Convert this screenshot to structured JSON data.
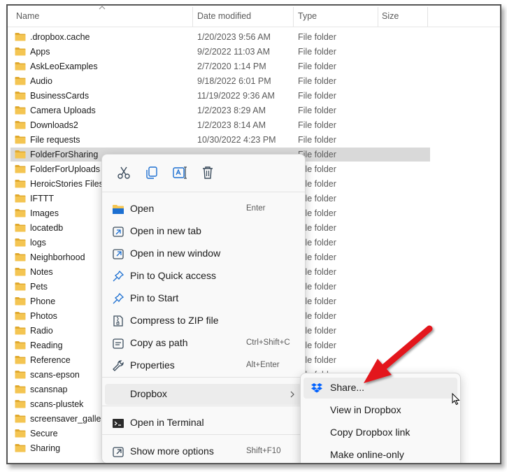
{
  "columns": [
    "Name",
    "Date modified",
    "Type",
    "Size"
  ],
  "rows": [
    {
      "name": ".dropbox.cache",
      "date": "1/20/2023 9:56 AM",
      "type": "File folder"
    },
    {
      "name": "Apps",
      "date": "9/2/2022 11:03 AM",
      "type": "File folder"
    },
    {
      "name": "AskLeoExamples",
      "date": "2/7/2020 1:14 PM",
      "type": "File folder"
    },
    {
      "name": "Audio",
      "date": "9/18/2022 6:01 PM",
      "type": "File folder"
    },
    {
      "name": "BusinessCards",
      "date": "11/19/2022 9:36 AM",
      "type": "File folder"
    },
    {
      "name": "Camera Uploads",
      "date": "1/2/2023 8:29 AM",
      "type": "File folder"
    },
    {
      "name": "Downloads2",
      "date": "1/2/2023 8:14 AM",
      "type": "File folder"
    },
    {
      "name": "File requests",
      "date": "10/30/2022 4:23 PM",
      "type": "File folder"
    },
    {
      "name": "FolderForSharing",
      "date": "",
      "type": "File folder",
      "selected": true
    },
    {
      "name": "FolderForUploads",
      "date": "",
      "type": "File folder"
    },
    {
      "name": "HeroicStories Files",
      "date": "",
      "type": "File folder"
    },
    {
      "name": "IFTTT",
      "date": "",
      "type": "File folder"
    },
    {
      "name": "Images",
      "date": "",
      "type": "File folder"
    },
    {
      "name": "locatedb",
      "date": "",
      "type": "File folder"
    },
    {
      "name": "logs",
      "date": "",
      "type": "File folder"
    },
    {
      "name": "Neighborhood",
      "date": "",
      "type": "File folder"
    },
    {
      "name": "Notes",
      "date": "",
      "type": "File folder"
    },
    {
      "name": "Pets",
      "date": "",
      "type": "File folder"
    },
    {
      "name": "Phone",
      "date": "",
      "type": "File folder"
    },
    {
      "name": "Photos",
      "date": "",
      "type": "File folder"
    },
    {
      "name": "Radio",
      "date": "",
      "type": "File folder"
    },
    {
      "name": "Reading",
      "date": "",
      "type": "File folder"
    },
    {
      "name": "Reference",
      "date": "",
      "type": "File folder"
    },
    {
      "name": "scans-epson",
      "date": "",
      "type": "File folder"
    },
    {
      "name": "scansnap",
      "date": "",
      "type": "File folder"
    },
    {
      "name": "scans-plustek",
      "date": "",
      "type": "File folder"
    },
    {
      "name": "screensaver_gallery",
      "date": "",
      "type": "File folder"
    },
    {
      "name": "Secure",
      "date": "",
      "type": "File folder"
    },
    {
      "name": "Sharing",
      "date": "",
      "type": "File folder"
    }
  ],
  "context_menu": {
    "quick_actions": [
      {
        "icon": "scissors-icon",
        "name": "cut"
      },
      {
        "icon": "copy-icon",
        "name": "copy"
      },
      {
        "icon": "rename-icon",
        "name": "rename"
      },
      {
        "icon": "trash-icon",
        "name": "delete"
      }
    ],
    "items": [
      {
        "label": "Open",
        "shortcut": "Enter",
        "icon": "folder-open-icon"
      },
      {
        "label": "Open in new tab",
        "shortcut": "",
        "icon": "new-tab-icon"
      },
      {
        "label": "Open in new window",
        "shortcut": "",
        "icon": "new-window-icon"
      },
      {
        "label": "Pin to Quick access",
        "shortcut": "",
        "icon": "pin-icon"
      },
      {
        "label": "Pin to Start",
        "shortcut": "",
        "icon": "pin-start-icon"
      },
      {
        "label": "Compress to ZIP file",
        "shortcut": "",
        "icon": "zip-icon"
      },
      {
        "label": "Copy as path",
        "shortcut": "Ctrl+Shift+C",
        "icon": "copy-path-icon"
      },
      {
        "label": "Properties",
        "shortcut": "Alt+Enter",
        "icon": "wrench-icon"
      },
      {
        "label": "Dropbox",
        "shortcut": "",
        "icon": "",
        "submenu": true
      },
      {
        "label": "Open in Terminal",
        "shortcut": "",
        "icon": "terminal-icon"
      },
      {
        "label": "Show more options",
        "shortcut": "Shift+F10",
        "icon": "more-options-icon"
      }
    ]
  },
  "dropbox_submenu": {
    "items": [
      {
        "label": "Share...",
        "icon": "dropbox-icon"
      },
      {
        "label": "View in Dropbox",
        "icon": ""
      },
      {
        "label": "Copy Dropbox link",
        "icon": ""
      },
      {
        "label": "Make online-only",
        "icon": ""
      }
    ]
  },
  "colors": {
    "folder": "#f4c552",
    "folder_dark": "#e0a92e",
    "accent": "#0a64c8",
    "annotation_arrow": "#e3121a",
    "dropbox": "#0061fe"
  }
}
